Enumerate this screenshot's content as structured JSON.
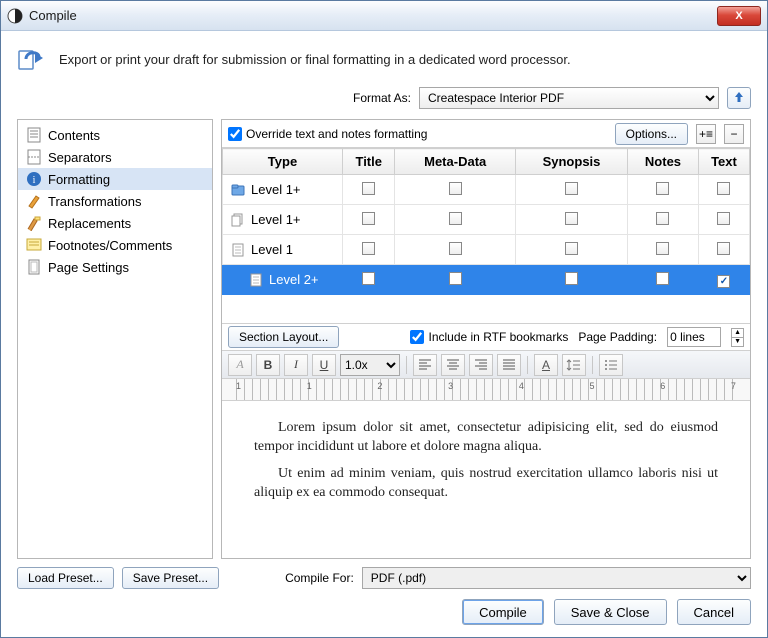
{
  "window": {
    "title": "Compile"
  },
  "close_label": "X",
  "description": "Export or print your draft for submission or final formatting in a dedicated word processor.",
  "format_as_label": "Format As:",
  "format_as_value": "Createspace Interior PDF",
  "sidebar": {
    "items": [
      {
        "label": "Contents"
      },
      {
        "label": "Separators"
      },
      {
        "label": "Formatting"
      },
      {
        "label": "Transformations"
      },
      {
        "label": "Replacements"
      },
      {
        "label": "Footnotes/Comments"
      },
      {
        "label": "Page Settings"
      }
    ]
  },
  "override_label": "Override text and notes formatting",
  "options_btn": "Options...",
  "table": {
    "headers": {
      "type": "Type",
      "title": "Title",
      "meta": "Meta-Data",
      "synopsis": "Synopsis",
      "notes": "Notes",
      "text": "Text"
    },
    "rows": [
      {
        "label": "Level 1+",
        "indent": 0,
        "icon": "folder-blue",
        "title": false,
        "meta": false,
        "synopsis": false,
        "notes": false,
        "text": false,
        "selected": false
      },
      {
        "label": "Level 1+",
        "indent": 0,
        "icon": "doc-group",
        "title": false,
        "meta": false,
        "synopsis": false,
        "notes": false,
        "text": false,
        "selected": false
      },
      {
        "label": "Level 1",
        "indent": 0,
        "icon": "doc",
        "title": false,
        "meta": false,
        "synopsis": false,
        "notes": false,
        "text": false,
        "selected": false
      },
      {
        "label": "Level 2+",
        "indent": 1,
        "icon": "doc",
        "title": false,
        "meta": false,
        "synopsis": false,
        "notes": false,
        "text": true,
        "selected": true
      }
    ]
  },
  "section_layout_btn": "Section Layout...",
  "include_rtf_label": "Include in RTF bookmarks",
  "page_padding_label": "Page Padding:",
  "page_padding_value": "0 lines",
  "zoom_value": "1.0x",
  "ruler_numbers": [
    "1",
    "",
    "1",
    "",
    "2",
    "",
    "3",
    "",
    "4",
    "",
    "5",
    "",
    "6",
    "",
    "7"
  ],
  "editor": {
    "p1": "Lorem ipsum dolor sit amet, consectetur adipisicing elit, sed do eiusmod tempor incididunt ut labore et dolore magna aliqua.",
    "p2": "Ut enim ad minim veniam, quis nostrud exercitation ullamco laboris nisi ut aliquip ex ea commodo consequat."
  },
  "load_preset_btn": "Load Preset...",
  "save_preset_btn": "Save Preset...",
  "compile_for_label": "Compile For:",
  "compile_for_value": "PDF (.pdf)",
  "compile_btn": "Compile",
  "save_close_btn": "Save & Close",
  "cancel_btn": "Cancel"
}
